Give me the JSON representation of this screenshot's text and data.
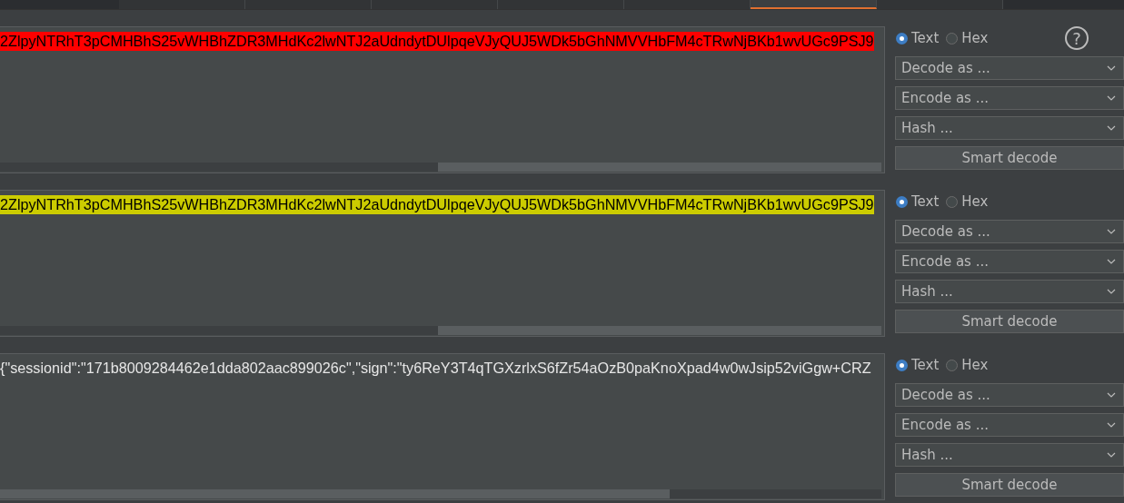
{
  "tab_bar": {
    "tabs": [
      {
        "selected": false
      },
      {
        "selected": false
      },
      {
        "selected": false
      },
      {
        "selected": false
      },
      {
        "selected": false
      },
      {
        "selected": true
      },
      {
        "selected": false
      }
    ]
  },
  "panels": [
    {
      "content": "2ZlpyNTRhT3pCMHBhS25vWHBhZDR3MHdKc2lwNTJ2aUdndytDUlpqeVJyQUJ5WDk5bGhNMVVHbFM4cTRwNjBKb1wvUGc9PSJ9",
      "color": "#ff0000",
      "mode": [
        {
          "label": "Text",
          "selected": true
        },
        {
          "label": "Hex",
          "selected": false
        }
      ],
      "help": "?",
      "dropdowns": [
        "Decode as ...",
        "Encode as ...",
        "Hash ..."
      ],
      "button": "Smart decode"
    },
    {
      "content": "2ZlpyNTRhT3pCMHBhS25vWHBhZDR3MHdKc2lwNTJ2aUdndytDUlpqeVJyQUJ5WDk5bGhNMVVHbFM4cTRwNjBKb1wvUGc9PSJ9",
      "color": "#cccc00",
      "mode": [
        {
          "label": "Text",
          "selected": true
        },
        {
          "label": "Hex",
          "selected": false
        }
      ],
      "dropdowns": [
        "Decode as ...",
        "Encode as ...",
        "Hash ..."
      ],
      "button": "Smart decode"
    },
    {
      "content": "{\"sessionid\":\"171b8009284462e1dda802aac899026c\",\"sign\":\"ty6ReY3T4qTGXzrlxS6fZr54aOzB0paKnoXpad4w0wJsip52viGgw+CRZ",
      "mode": [
        {
          "label": "Text",
          "selected": true
        },
        {
          "label": "Hex",
          "selected": false
        }
      ],
      "dropdowns": [
        "Decode as ...",
        "Encode as ...",
        "Hash ..."
      ],
      "button": "Smart decode"
    }
  ]
}
